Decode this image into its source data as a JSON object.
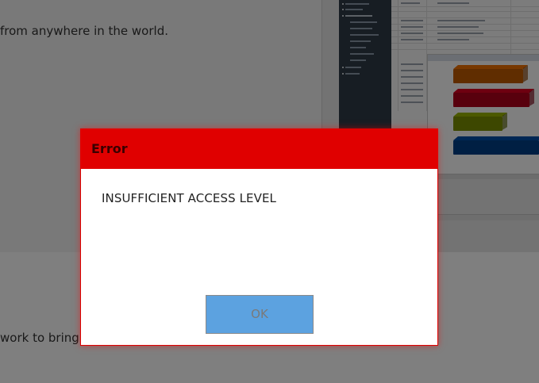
{
  "background": {
    "text_line_1": "from anywhere in the world.",
    "text_line_2": "work to bring y"
  },
  "dialog": {
    "title": "Error",
    "message": "INSUFFICIENT ACCESS LEVEL",
    "ok_label": "OK"
  },
  "colors": {
    "header_red": "#e00000",
    "ok_blue": "#5ca2e0",
    "overlay": "rgba(0,0,0,0.5)"
  }
}
